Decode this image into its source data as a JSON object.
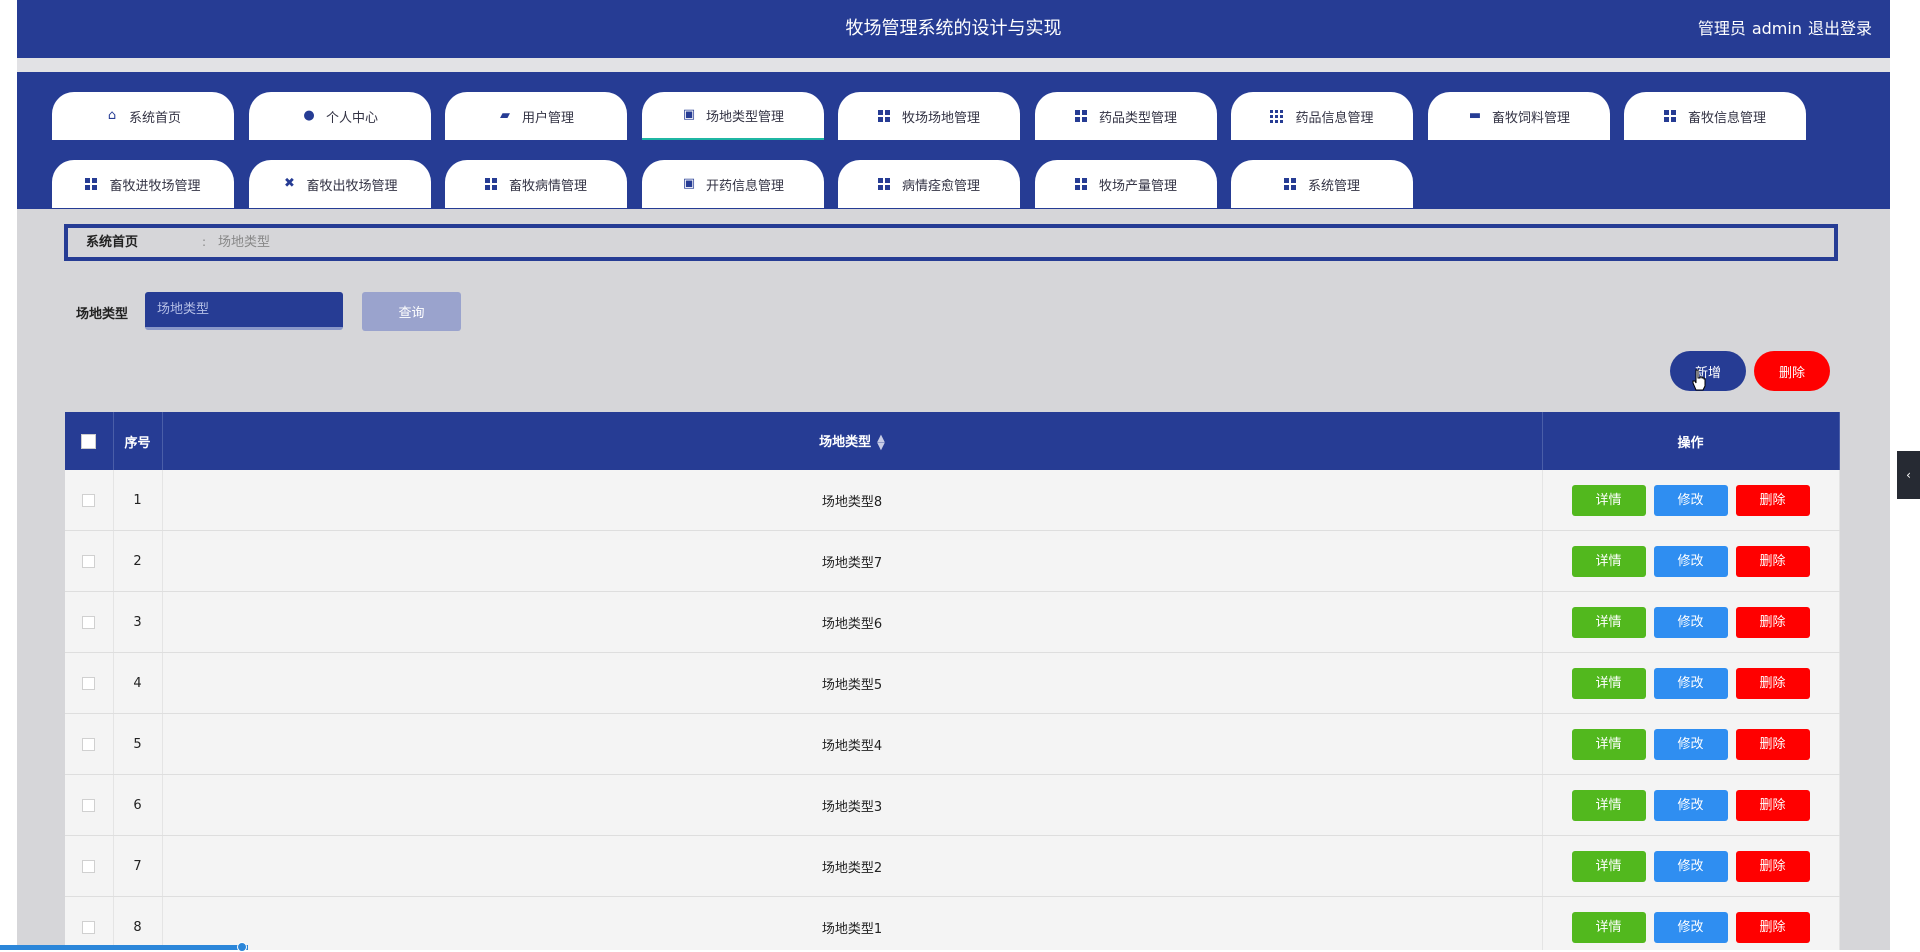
{
  "header": {
    "title": "牧场管理系统的设计与实现",
    "role": "管理员",
    "username": "admin",
    "logout": "退出登录"
  },
  "nav": {
    "tabs": [
      {
        "label": "系统首页",
        "icon": "home-icon"
      },
      {
        "label": "个人中心",
        "icon": "user-icon"
      },
      {
        "label": "用户管理",
        "icon": "wallet-icon"
      },
      {
        "label": "场地类型管理",
        "icon": "clipboard-icon",
        "active": true
      },
      {
        "label": "牧场场地管理",
        "icon": "grid-icon"
      },
      {
        "label": "药品类型管理",
        "icon": "grid-icon"
      },
      {
        "label": "药品信息管理",
        "icon": "grid9-icon"
      },
      {
        "label": "畜牧饲料管理",
        "icon": "briefcase-icon"
      },
      {
        "label": "畜牧信息管理",
        "icon": "grid-icon"
      },
      {
        "label": "畜牧进牧场管理",
        "icon": "grid-icon"
      },
      {
        "label": "畜牧出牧场管理",
        "icon": "ticket-icon"
      },
      {
        "label": "畜牧病情管理",
        "icon": "grid-icon"
      },
      {
        "label": "开药信息管理",
        "icon": "clipboard-icon"
      },
      {
        "label": "病情痊愈管理",
        "icon": "grid-icon"
      },
      {
        "label": "牧场产量管理",
        "icon": "grid-icon"
      },
      {
        "label": "系统管理",
        "icon": "grid-icon"
      }
    ]
  },
  "breadcrumb": {
    "home": "系统首页",
    "separator": ":",
    "current": "场地类型"
  },
  "search": {
    "label": "场地类型",
    "placeholder": "场地类型",
    "button": "查询"
  },
  "actions": {
    "add": "新增",
    "delete": "删除"
  },
  "table": {
    "columns": {
      "index": "序号",
      "type": "场地类型",
      "ops": "操作"
    },
    "op_labels": {
      "detail": "详情",
      "edit": "修改",
      "delete": "删除"
    },
    "rows": [
      {
        "index": "1",
        "type": "场地类型8"
      },
      {
        "index": "2",
        "type": "场地类型7"
      },
      {
        "index": "3",
        "type": "场地类型6"
      },
      {
        "index": "4",
        "type": "场地类型5"
      },
      {
        "index": "5",
        "type": "场地类型4"
      },
      {
        "index": "6",
        "type": "场地类型3"
      },
      {
        "index": "7",
        "type": "场地类型2"
      },
      {
        "index": "8",
        "type": "场地类型1"
      }
    ]
  },
  "colors": {
    "primary": "#263c94",
    "success": "#52b81e",
    "info": "#2f8ef1",
    "danger": "#ff0000",
    "background": "#d6d6d9"
  }
}
